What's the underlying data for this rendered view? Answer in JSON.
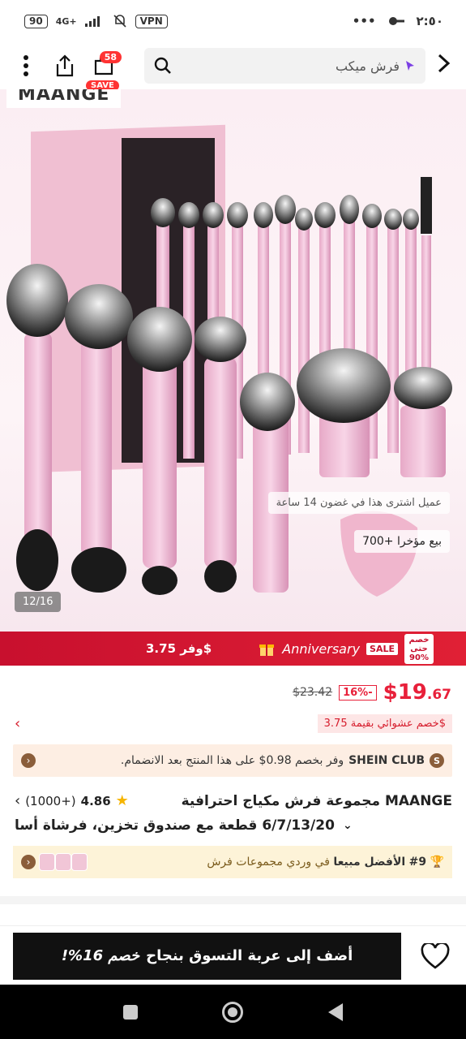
{
  "status_bar": {
    "battery": "90",
    "network": "4G+",
    "vpn": "VPN",
    "time": "٢:٥٠",
    "dots": "•••"
  },
  "top_bar": {
    "cart_count": "58",
    "save_label": "SAVE",
    "search_text": "فرش ميكب"
  },
  "gallery": {
    "brand": "MAANGE",
    "counter": "12/16",
    "recent_purchase": "عميل اشترى هذا في غضون 14 ساعة",
    "sales": "700+ بيع مؤخرا"
  },
  "promo_strip": {
    "anniversary": "Anniversary",
    "sale": "SALE",
    "save_text": "وفر 3.75$",
    "discount_badge": "خصم حتى %90"
  },
  "price": {
    "currency": "$",
    "integer": "19",
    "decimal": ".67",
    "discount_pct": "-16%",
    "original": "$23.42"
  },
  "random_discount": "خصم عشوائي بقيمة 3.75$",
  "shein_club": {
    "icon": "S",
    "name": "SHEIN CLUB",
    "text": "وفر بخصم 0.98$ على هذا المنتج بعد الانضمام."
  },
  "product": {
    "title_line1": "MAANGE مجموعة فرش مكياج احترافية",
    "title_line2": "6/7/13/20 قطعة مع صندوق تخزين، فرشاة أسا",
    "rating": "4.86",
    "reviews": "(1000+)"
  },
  "best_seller": {
    "rank": "#9",
    "bold": "الأفضل مبيعا",
    "text": "في وردي مجموعات فرش"
  },
  "cta": {
    "discount": "خصم 16%!",
    "label": "أضف إلى عربة التسوق بنجاح"
  }
}
